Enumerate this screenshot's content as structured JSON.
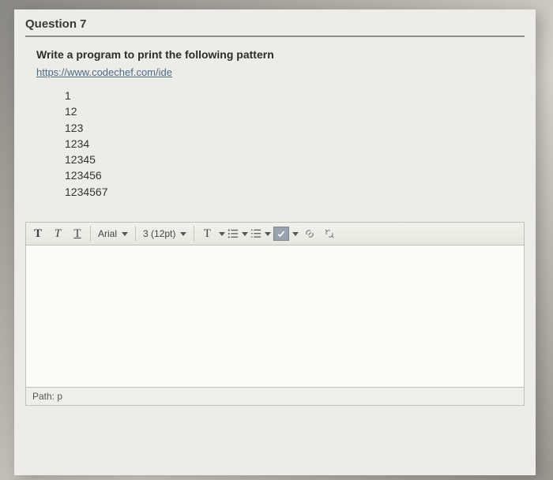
{
  "question": {
    "label": "Question 7"
  },
  "prompt": "Write a program to print the following pattern",
  "link": {
    "text": "https://www.codechef.com/ide"
  },
  "pattern_lines": [
    "1",
    "12",
    "123",
    "1234",
    "12345",
    "123456",
    "1234567"
  ],
  "toolbar": {
    "bold": "T",
    "italic": "T",
    "underline": "T",
    "font": "Arial",
    "size": "3 (12pt)",
    "textcolor": "T"
  },
  "pathbar": {
    "label": "Path:",
    "value": "p"
  }
}
